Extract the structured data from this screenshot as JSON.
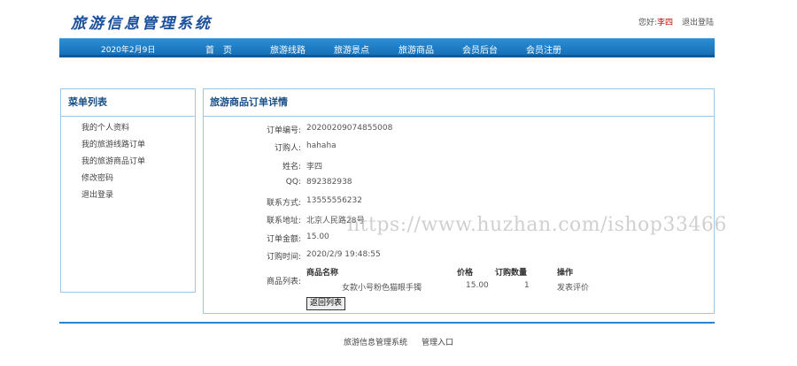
{
  "header": {
    "logo_text": "旅游信息管理系统",
    "greeting": "您好:",
    "username": "李四",
    "logout": "退出登陆"
  },
  "nav": {
    "date": "2020年2月9日",
    "items": [
      "首　页",
      "旅游线路",
      "旅游景点",
      "旅游商品",
      "会员后台",
      "会员注册"
    ]
  },
  "sidebar": {
    "title": "菜单列表",
    "items": [
      "我的个人资料",
      "我的旅游线路订单",
      "我的旅游商品订单",
      "修改密码",
      "退出登录"
    ]
  },
  "detail": {
    "title": "旅游商品订单详情",
    "fields": [
      {
        "label": "订单编号:",
        "value": "20200209074855008"
      },
      {
        "label": "订购人:",
        "value": "hahaha"
      },
      {
        "label": "姓名:",
        "value": "李四"
      },
      {
        "label": "QQ:",
        "value": "892382938"
      },
      {
        "label": "联系方式:",
        "value": "13555556232"
      },
      {
        "label": "联系地址:",
        "value": "北京人民路28号"
      },
      {
        "label": "订单金额:",
        "value": "15.00"
      },
      {
        "label": "订购时间:",
        "value": "2020/2/9 19:48:55"
      }
    ],
    "products_label": "商品列表:",
    "product_columns": [
      "商品名称",
      "价格",
      "订购数量",
      "操作"
    ],
    "product_rows": [
      {
        "name": "女款小号粉色猫眼手镯",
        "price": "15.00",
        "qty": "1",
        "action": "发表评价"
      }
    ],
    "back_button": "返回列表"
  },
  "footer": {
    "links": [
      "旅游信息管理系统",
      "管理入口"
    ]
  },
  "watermark": "https://www.huzhan.com/ishop33466"
}
